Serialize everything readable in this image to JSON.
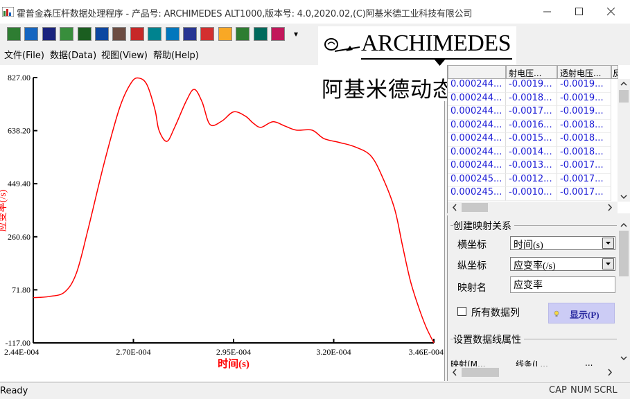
{
  "window": {
    "title": "霍普金森压杆数据处理程序 - 产品号: ARCHIMEDES ALT1000,版本号: 4.0,2020.02,(C)阿基米德工业科技有限公司",
    "minimize_icon": "minimize-icon",
    "maximize_icon": "maximize-icon",
    "close_icon": "close-icon"
  },
  "toolbar": {
    "buttons": [
      {
        "name": "open-icon",
        "color": "#2e7d32"
      },
      {
        "name": "open-folder-icon",
        "color": "#1565c0"
      },
      {
        "name": "save-icon",
        "color": "#1a237e"
      },
      {
        "name": "document-icon",
        "color": "#388e3c"
      },
      {
        "name": "table-icon",
        "color": "#1b5e20"
      },
      {
        "name": "chart-icon",
        "color": "#0d47a1"
      },
      {
        "name": "list-icon",
        "color": "#6d4c41"
      },
      {
        "name": "image-icon",
        "color": "#c62828"
      },
      {
        "name": "tool-icon",
        "color": "#00838f"
      },
      {
        "name": "refresh-icon",
        "color": "#0277bd"
      },
      {
        "name": "grid-icon",
        "color": "#283593"
      },
      {
        "name": "delete-icon",
        "color": "#d32f2f"
      },
      {
        "name": "help-icon",
        "color": "#f9a825"
      },
      {
        "name": "export-icon",
        "color": "#2e7d32"
      },
      {
        "name": "plot-icon",
        "color": "#00695c"
      },
      {
        "name": "settings-icon",
        "color": "#c2185b"
      }
    ],
    "more": "▾"
  },
  "logo": {
    "brand": "ARCHIMEDES",
    "chinese": "阿基米德动态力学"
  },
  "menu": {
    "file": "文件(File)",
    "data": "数据(Data)",
    "view": "视图(View)",
    "help": "帮助(Help)"
  },
  "chart_data": {
    "type": "line",
    "xlabel": "时间(s)",
    "ylabel": "应变率(/s)",
    "xlim": [
      0.000244,
      0.000346
    ],
    "ylim": [
      -117.0,
      827.0
    ],
    "x_ticks": [
      "2.44E-004",
      "2.70E-004",
      "2.95E-004",
      "3.20E-004",
      "3.46E-004"
    ],
    "y_ticks": [
      "827.00",
      "638.20",
      "449.40",
      "260.60",
      "71.80",
      "-117.00"
    ],
    "series": [
      {
        "color": "#ff0000",
        "x": [
          0.000244,
          0.000248,
          0.000252,
          0.000255,
          0.000258,
          0.000262,
          0.000266,
          0.000269,
          0.000271,
          0.000273,
          0.000275,
          0.000276,
          0.000278,
          0.00028,
          0.000283,
          0.000285,
          0.000287,
          0.000289,
          0.000292,
          0.000295,
          0.000298,
          0.0003,
          0.000302,
          0.000305,
          0.000308,
          0.000311,
          0.000315,
          0.000318,
          0.000322,
          0.000326,
          0.00033,
          0.000333,
          0.000336,
          0.000338,
          0.00034,
          0.000342,
          0.000344,
          0.000346
        ],
        "y": [
          44,
          48,
          64,
          132,
          290,
          520,
          720,
          810,
          825,
          800,
          712,
          640,
          600,
          650,
          745,
          785,
          740,
          660,
          672,
          705,
          690,
          665,
          650,
          670,
          655,
          640,
          640,
          610,
          596,
          580,
          548,
          470,
          360,
          230,
          105,
          15,
          -60,
          -117
        ]
      }
    ]
  },
  "table": {
    "headers": [
      "",
      "射电压...",
      "透射电压...",
      "反"
    ],
    "rows": [
      [
        "0.000244...",
        "-0.0019...",
        "-0.0019..."
      ],
      [
        "0.000244...",
        "-0.0018...",
        "-0.0019..."
      ],
      [
        "0.000244...",
        "-0.0017...",
        "-0.0019..."
      ],
      [
        "0.000244...",
        "-0.0016...",
        "-0.0018..."
      ],
      [
        "0.000244...",
        "-0.0015...",
        "-0.0018..."
      ],
      [
        "0.000244...",
        "-0.0014...",
        "-0.0018..."
      ],
      [
        "0.000244...",
        "-0.0013...",
        "-0.0017..."
      ],
      [
        "0.000245...",
        "-0.0012...",
        "-0.0017..."
      ],
      [
        "0.000245...",
        "-0.0010...",
        "-0.0017..."
      ]
    ]
  },
  "mapping": {
    "group_title": "创建映射关系",
    "x_label": "横坐标",
    "x_value": "时间(s)",
    "y_label": "纵坐标",
    "y_value": "应变率(/s)",
    "name_label": "映射名",
    "name_value": "应变率",
    "all_columns_label": "所有数据列",
    "show_button": "显示(P)",
    "line_group_title": "设置数据线属性",
    "bottom_tabs": [
      "映射(M...",
      "线条(L...",
      "..."
    ]
  },
  "status": {
    "text": "Ready",
    "cap": "CAP",
    "num": "NUM",
    "scrl": "SCRL"
  }
}
